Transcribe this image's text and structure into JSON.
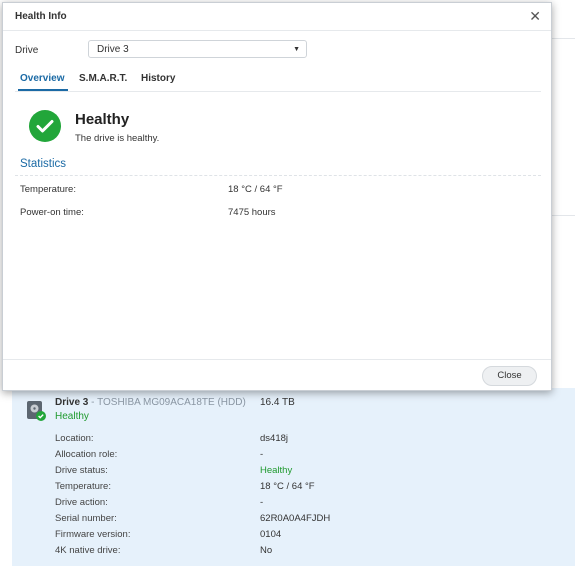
{
  "dialog": {
    "title": "Health Info",
    "close_glyph": "✕",
    "drive_label": "Drive",
    "drive_select_value": "Drive 3",
    "tabs": [
      {
        "label": "Overview",
        "active": true
      },
      {
        "label": "S.M.A.R.T.",
        "active": false
      },
      {
        "label": "History",
        "active": false
      }
    ],
    "status": {
      "title": "Healthy",
      "description": "The drive is healthy.",
      "icon": "check-circle-icon",
      "color": "#22a63a"
    },
    "statistics": {
      "title": "Statistics",
      "rows": [
        {
          "label": "Temperature:",
          "value": "18 °C / 64 °F"
        },
        {
          "label": "Power-on time:",
          "value": "7475 hours"
        }
      ]
    },
    "close_button": "Close"
  },
  "drive_detail": {
    "name": "Drive 3",
    "model": " - TOSHIBA MG09ACA18TE (HDD)",
    "size": "16.4 TB",
    "health": "Healthy",
    "rows": [
      {
        "label": "Location:",
        "value": "ds418j"
      },
      {
        "label": "Allocation role:",
        "value": "-"
      },
      {
        "label": "Drive status:",
        "value": "Healthy"
      },
      {
        "label": "Temperature:",
        "value": "18 °C / 64 °F"
      },
      {
        "label": "Drive action:",
        "value": "-"
      },
      {
        "label": "Serial number:",
        "value": "62R0A0A4FJDH"
      },
      {
        "label": "Firmware version:",
        "value": "0104"
      },
      {
        "label": "4K native drive:",
        "value": "No"
      }
    ]
  }
}
